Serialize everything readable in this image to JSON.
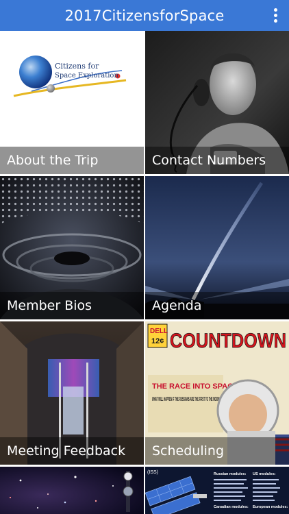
{
  "app": {
    "title": "2017CitizensforSpace",
    "overflow_icon": "more-vertical-icon"
  },
  "logo": {
    "line1": "Citizens for",
    "line2": "Space Exploration"
  },
  "tiles": [
    {
      "label": "About the Trip",
      "image": "citizens-for-space-exploration-logo"
    },
    {
      "label": "Contact Numbers",
      "image": "astronaut-on-telephone-photo"
    },
    {
      "label": "Member Bios",
      "image": "auditorium-seating-photo"
    },
    {
      "label": "Agenda",
      "image": "rocket-launch-night-photo"
    },
    {
      "label": "Meeting Feedback",
      "image": "exhibit-hall-photo"
    },
    {
      "label": "Scheduling",
      "image": "countdown-comic-cover"
    },
    {
      "label": "",
      "image": "starfield-photo"
    },
    {
      "label": "",
      "image": "space-station-modules-diagram"
    }
  ],
  "comic": {
    "publisher": "DELL",
    "price": "12¢",
    "title": "COUNTDOWN",
    "headline": "THE RACE INTO SPACE",
    "question": "WHAT WILL HAPPEN IF THE RUSSIANS ARE THE FIRST TO THE MOON?"
  },
  "iss_chart": {
    "title": "(ISS)",
    "russian_heading": "Russian modules:",
    "us_heading": "US modules:",
    "canadian_heading": "Canadian modules:",
    "european_heading": "European modules:"
  }
}
